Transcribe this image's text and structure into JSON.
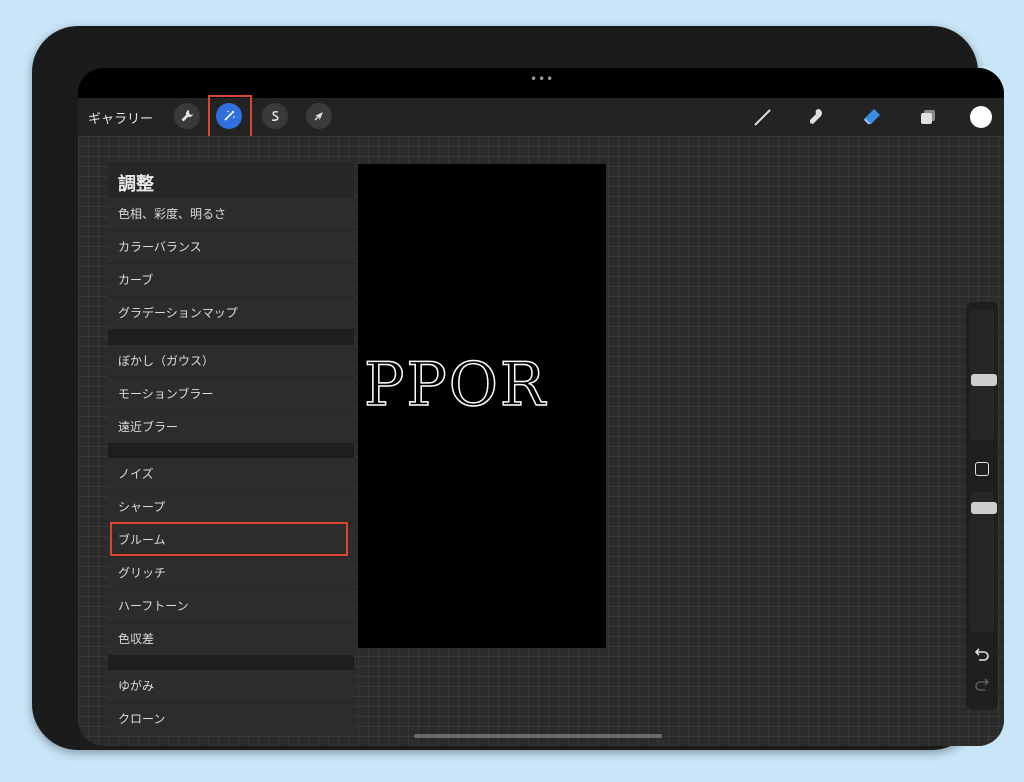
{
  "toolbar": {
    "gallery_label": "ギャラリー",
    "menu_dots": "•••"
  },
  "icons": {
    "actions": "wrench-icon",
    "adjustments": "magic-wand-icon",
    "selection": "s-selection-icon",
    "transform": "arrow-cursor-icon",
    "brush": "brush-icon",
    "smudge": "smudge-icon",
    "eraser": "eraser-icon",
    "layers": "layers-icon",
    "color": "color-circle-icon"
  },
  "canvas": {
    "art_text": "PPOR"
  },
  "adjustments_panel": {
    "title": "調整",
    "groups": [
      [
        "色相、彩度、明るさ",
        "カラーバランス",
        "カーブ",
        "グラデーションマップ"
      ],
      [
        "ぼかし（ガウス）",
        "モーションブラー",
        "遠近ブラー"
      ],
      [
        "ノイズ",
        "シャープ",
        "ブルーム",
        "グリッチ",
        "ハーフトーン",
        "色収差"
      ],
      [
        "ゆがみ",
        "クローン"
      ]
    ],
    "highlighted_item": "ブルーム"
  },
  "colors": {
    "accent": "#2f6fe0",
    "highlight_border": "#d9462e",
    "color_swatch": "#ffffff"
  }
}
